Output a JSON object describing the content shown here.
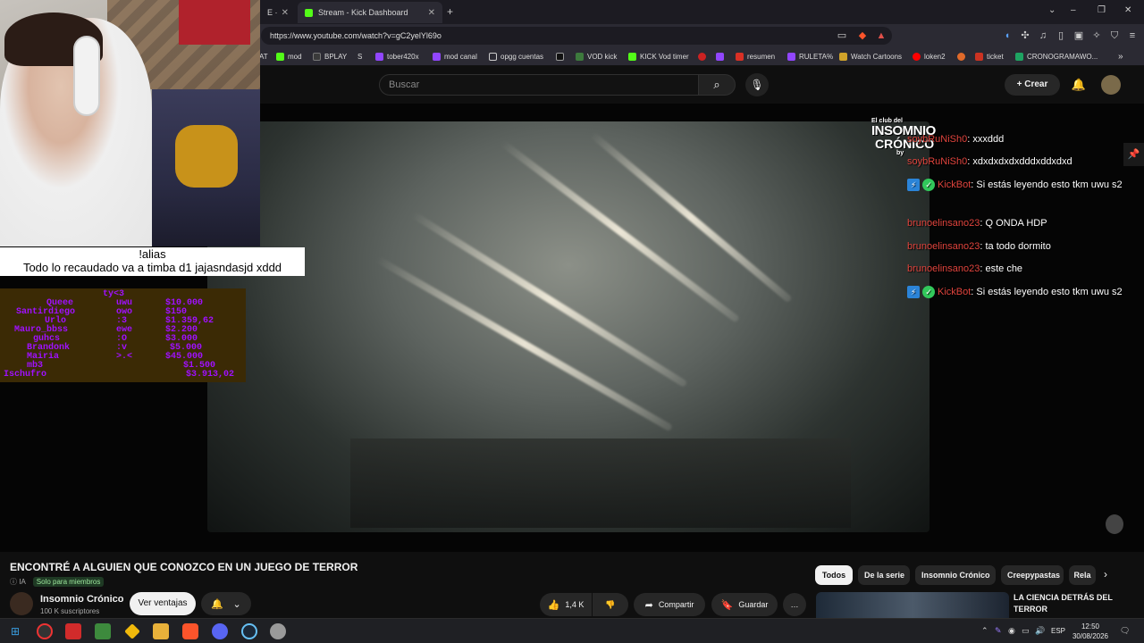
{
  "browser": {
    "tabs": [
      {
        "label": "E ·",
        "active": false
      },
      {
        "label": "Stream - Kick Dashboard",
        "active": false
      }
    ],
    "new_tab": "+",
    "url": "https://www.youtube.com/watch?v=gC2yelYl69o",
    "window_controls": [
      "⌄",
      "–",
      "❐",
      "✕"
    ],
    "bookmarks": [
      {
        "label": "AT",
        "color": "#888888"
      },
      {
        "label": "mod",
        "color": "#53fc18"
      },
      {
        "label": "BPLAY",
        "color": "#3a3a3a"
      },
      {
        "label": "S",
        "color": "#555555"
      },
      {
        "label": "tober420x",
        "color": "#9146ff"
      },
      {
        "label": "mod canal",
        "color": "#9146ff"
      },
      {
        "label": "opgg cuentas",
        "color": "#777777"
      },
      {
        "label": "",
        "color": "#111111"
      },
      {
        "label": "VOD kick",
        "color": "#3d7a3d"
      },
      {
        "label": "KICK Vod timer",
        "color": "#53fc18"
      },
      {
        "label": "",
        "color": "#cc2222"
      },
      {
        "label": "",
        "color": "#9146ff"
      },
      {
        "label": "resumen",
        "color": "#d93025"
      },
      {
        "label": "RULETA%",
        "color": "#9146ff"
      },
      {
        "label": "Watch Cartoons",
        "color": "#d1a32a"
      },
      {
        "label": "loken2",
        "color": "#ff0000"
      },
      {
        "label": "",
        "color": "#e06a2a"
      },
      {
        "label": "ticket",
        "color": "#cc3322"
      },
      {
        "label": "CRONOGRAMAWO...",
        "color": "#1ea362"
      }
    ]
  },
  "youtube_header": {
    "search_placeholder": "Buscar",
    "create_label": "Crear"
  },
  "video_overlay": {
    "logo_line1": "El club del",
    "logo_line2": "INSOMNIO",
    "logo_line3": "CRÓNICO",
    "logo_by": "by"
  },
  "chat": [
    {
      "user": "soybRuNiSh0",
      "text": ": xxxddd",
      "bot": false
    },
    {
      "user": "soybRuNiSh0",
      "text": ": xdxdxdxdxdddxddxdxd",
      "bot": false
    },
    {
      "user": "KickBot",
      "text": ": Si estás leyendo esto tkm uwu s2",
      "bot": true
    },
    {
      "user": "brunoelinsano23",
      "text": ": Q ONDA HDP",
      "bot": false
    },
    {
      "user": "brunoelinsano23",
      "text": ": ta todo dormito",
      "bot": false
    },
    {
      "user": "brunoelinsano23",
      "text": ": este che",
      "bot": false
    },
    {
      "user": "KickBot",
      "text": ": Si estás leyendo esto tkm uwu s2",
      "bot": true
    }
  ],
  "stream_overlay": {
    "alias_line1": "!alias",
    "alias_line2": "Todo lo recaudado va a timba d1 jajasndasjd xddd"
  },
  "donations": {
    "header": "ty<3",
    "rows": [
      {
        "name": "Queee",
        "emote": "uwu",
        "amount": "$10.000"
      },
      {
        "name": "Santirdiego",
        "emote": "owo",
        "amount": "$150"
      },
      {
        "name": "Urlo",
        "emote": ":3",
        "amount": "$1.359,62"
      },
      {
        "name": "Mauro_bbss",
        "emote": "ewe",
        "amount": "$2.200"
      },
      {
        "name": "guhcs",
        "emote": ":O",
        "amount": "$3.000"
      },
      {
        "name": "Brandonk",
        "emote": ":v",
        "amount": "$5.000"
      },
      {
        "name": "Mairia",
        "emote": ">.<",
        "amount": "$45.000"
      },
      {
        "name": "mb3",
        "emote": "",
        "amount": "$1.500"
      },
      {
        "name": "Ischufro",
        "emote": "",
        "amount": "$3.913,02"
      }
    ]
  },
  "video": {
    "title": "ENCONTRÉ A ALGUIEN QUE CONOZCO EN UN JUEGO DE TERROR",
    "ia_label": "IA",
    "members_label": "Solo para miembros",
    "channel_name": "Insomnio Crónico",
    "channel_subs": "100 K suscriptores",
    "sales_button": "Ver ventajas",
    "likes": "1,4 K",
    "share": "Compartir",
    "save": "Guardar",
    "more": "…"
  },
  "chips": [
    "Todos",
    "De la serie",
    "Insomnio Crónico",
    "Creepypastas",
    "Rela"
  ],
  "recommendation": {
    "title": "LA CIENCIA DETRÁS DEL TERROR"
  },
  "taskbar": {
    "lang": "ESP",
    "time": "12:50",
    "date": "30/08/2026",
    "apps": [
      {
        "name": "start",
        "color": "#3a9bdc"
      },
      {
        "name": "search",
        "color": "#555555"
      },
      {
        "name": "app-red",
        "color": "#d12b2b"
      },
      {
        "name": "app-green",
        "color": "#3d8a3d"
      },
      {
        "name": "binance",
        "color": "#f0b90b"
      },
      {
        "name": "explorer",
        "color": "#e8b13a"
      },
      {
        "name": "brave",
        "color": "#fb542b"
      },
      {
        "name": "discord",
        "color": "#5865f2"
      },
      {
        "name": "steam",
        "color": "#1b2838"
      },
      {
        "name": "app-grey",
        "color": "#9a9a9a"
      }
    ]
  }
}
